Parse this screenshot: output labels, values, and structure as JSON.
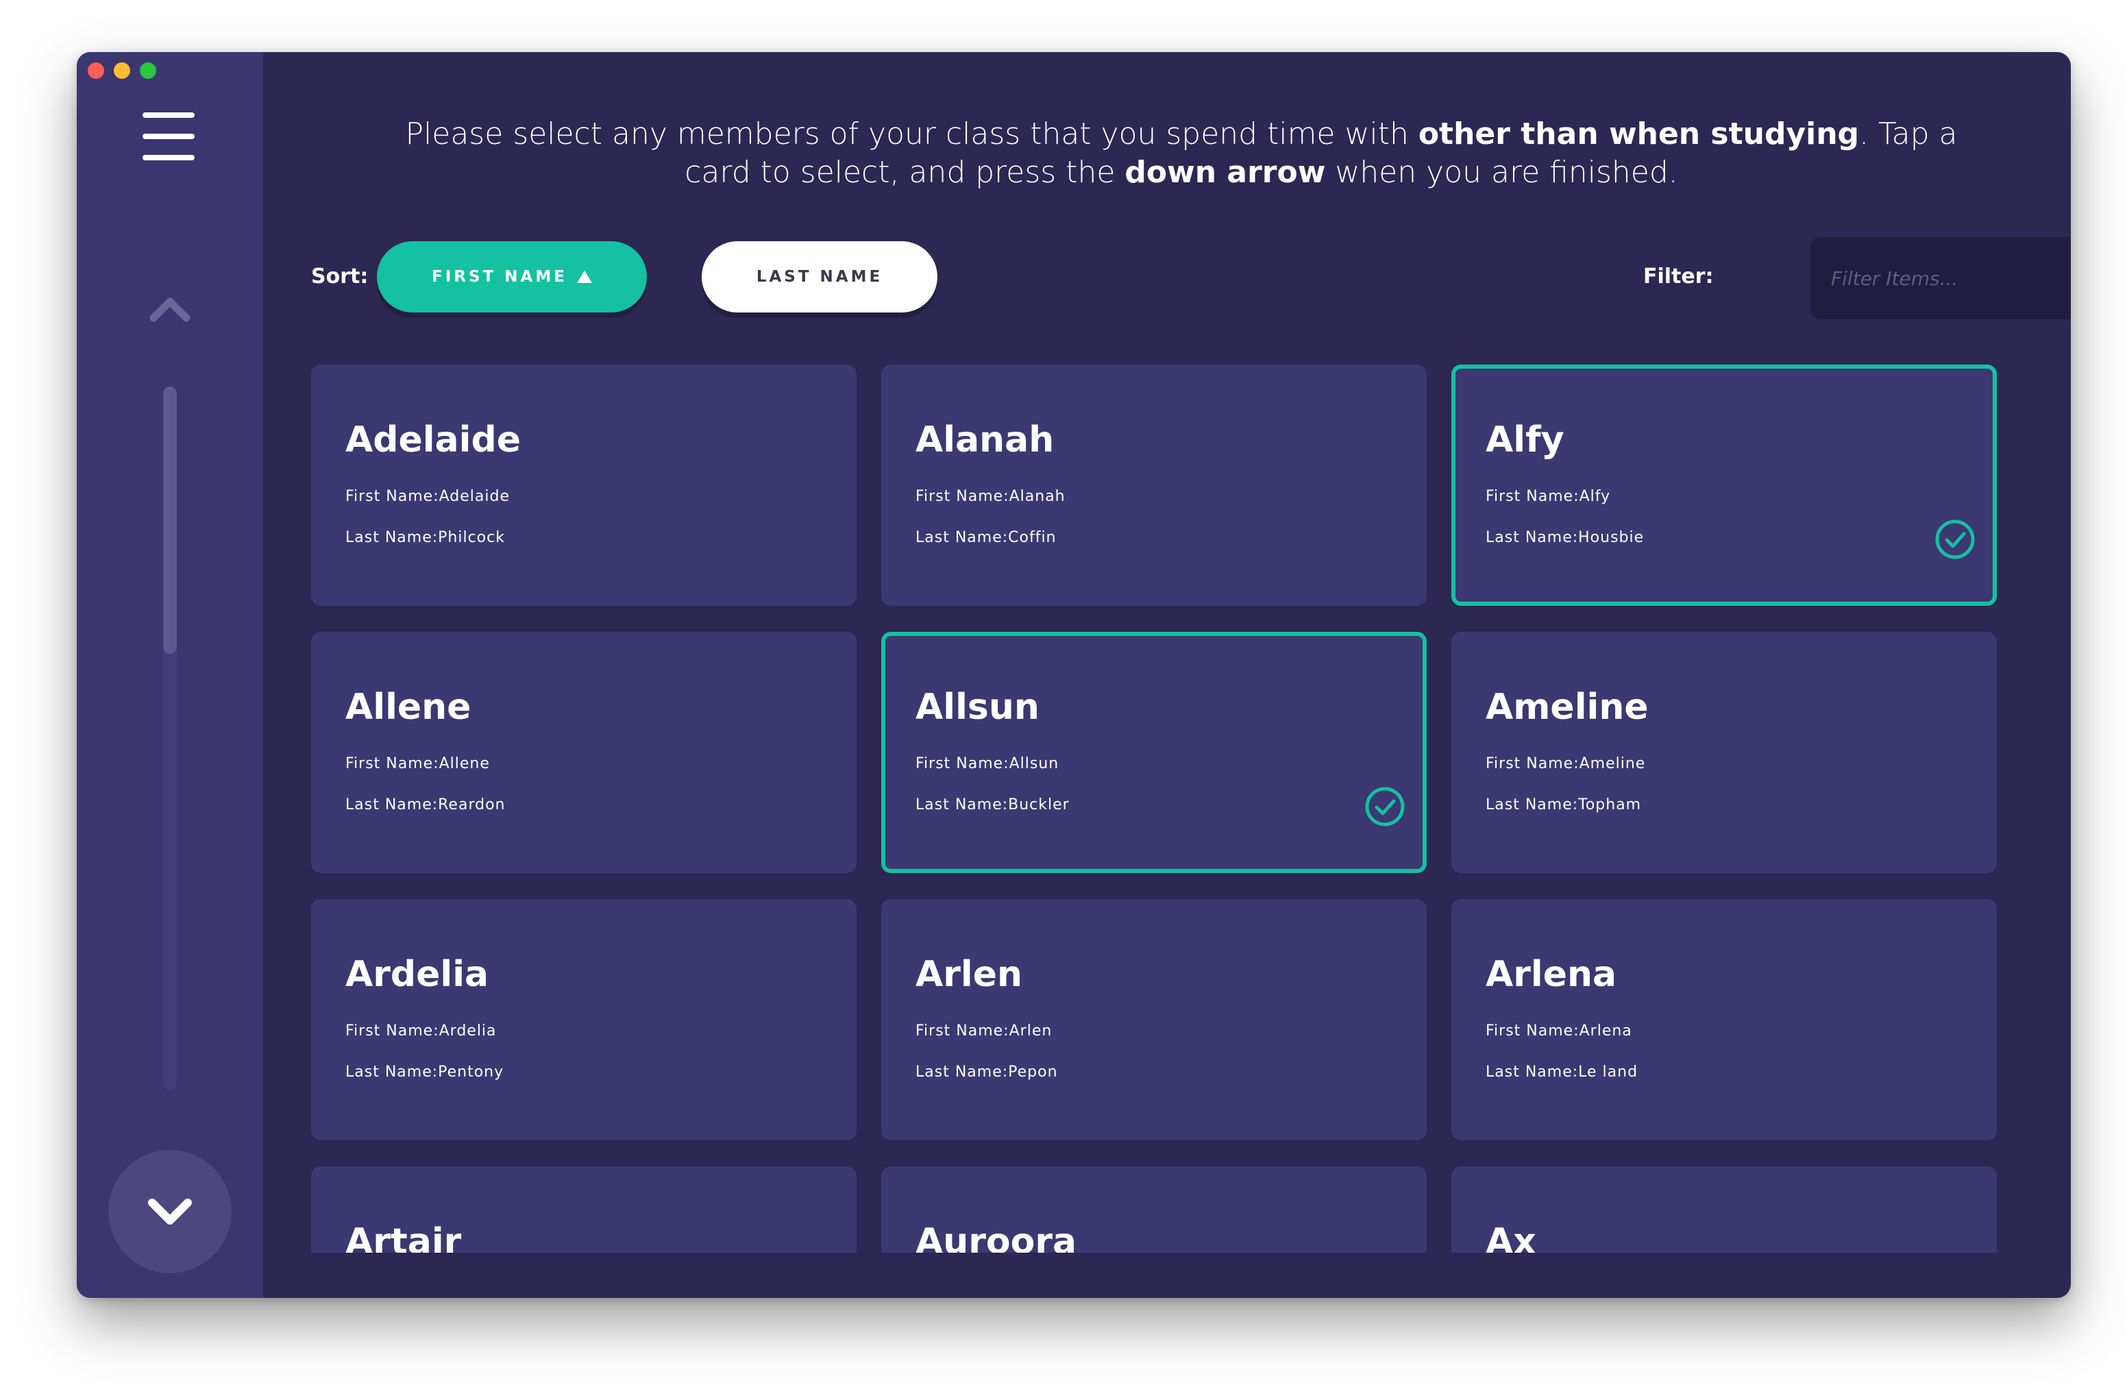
{
  "instructions": {
    "part1": "Please select any members of your class that you spend time with ",
    "bold1": "other than when studying",
    "part2": ". Tap a card to select, and press the ",
    "bold2": "down arrow",
    "part3": " when you are finished."
  },
  "sort": {
    "label": "Sort:",
    "first_name": "FIRST NAME",
    "last_name": "LAST NAME",
    "active": "first_name",
    "direction": "ascending"
  },
  "filter": {
    "label": "Filter:",
    "placeholder": "Filter Items...",
    "value": ""
  },
  "scrollbar": {
    "scroll_fraction": 0.0,
    "visible_fraction": 0.38
  },
  "colors": {
    "accent": "#14c1a0",
    "window_bg": "#2c2753",
    "sidebar_bg": "#3b3570",
    "card_bg": "#3b3872"
  },
  "icons": {
    "menu": "hamburger-icon",
    "scroll_up": "chevron-up-icon",
    "finish": "chevron-down-icon",
    "selected": "check-circle-icon"
  },
  "cards": [
    {
      "name": "Adelaide",
      "first_label": "First Name:Adelaide",
      "last_label": "Last Name:Philcock",
      "selected": false
    },
    {
      "name": "Alanah",
      "first_label": "First Name:Alanah",
      "last_label": "Last Name:Coffin",
      "selected": false
    },
    {
      "name": "Alfy",
      "first_label": "First Name:Alfy",
      "last_label": "Last Name:Housbie",
      "selected": true
    },
    {
      "name": "Allene",
      "first_label": "First Name:Allene",
      "last_label": "Last Name:Reardon",
      "selected": false
    },
    {
      "name": "Allsun",
      "first_label": "First Name:Allsun",
      "last_label": "Last Name:Buckler",
      "selected": true
    },
    {
      "name": "Ameline",
      "first_label": "First Name:Ameline",
      "last_label": "Last Name:Topham",
      "selected": false
    },
    {
      "name": "Ardelia",
      "first_label": "First Name:Ardelia",
      "last_label": "Last Name:Pentony",
      "selected": false
    },
    {
      "name": "Arlen",
      "first_label": "First Name:Arlen",
      "last_label": "Last Name:Pepon",
      "selected": false
    },
    {
      "name": "Arlena",
      "first_label": "First Name:Arlena",
      "last_label": "Last Name:Le land",
      "selected": false
    },
    {
      "name": "Artair",
      "selected": false
    },
    {
      "name": "Auroora",
      "selected": false
    },
    {
      "name": "Ax",
      "selected": false
    }
  ]
}
